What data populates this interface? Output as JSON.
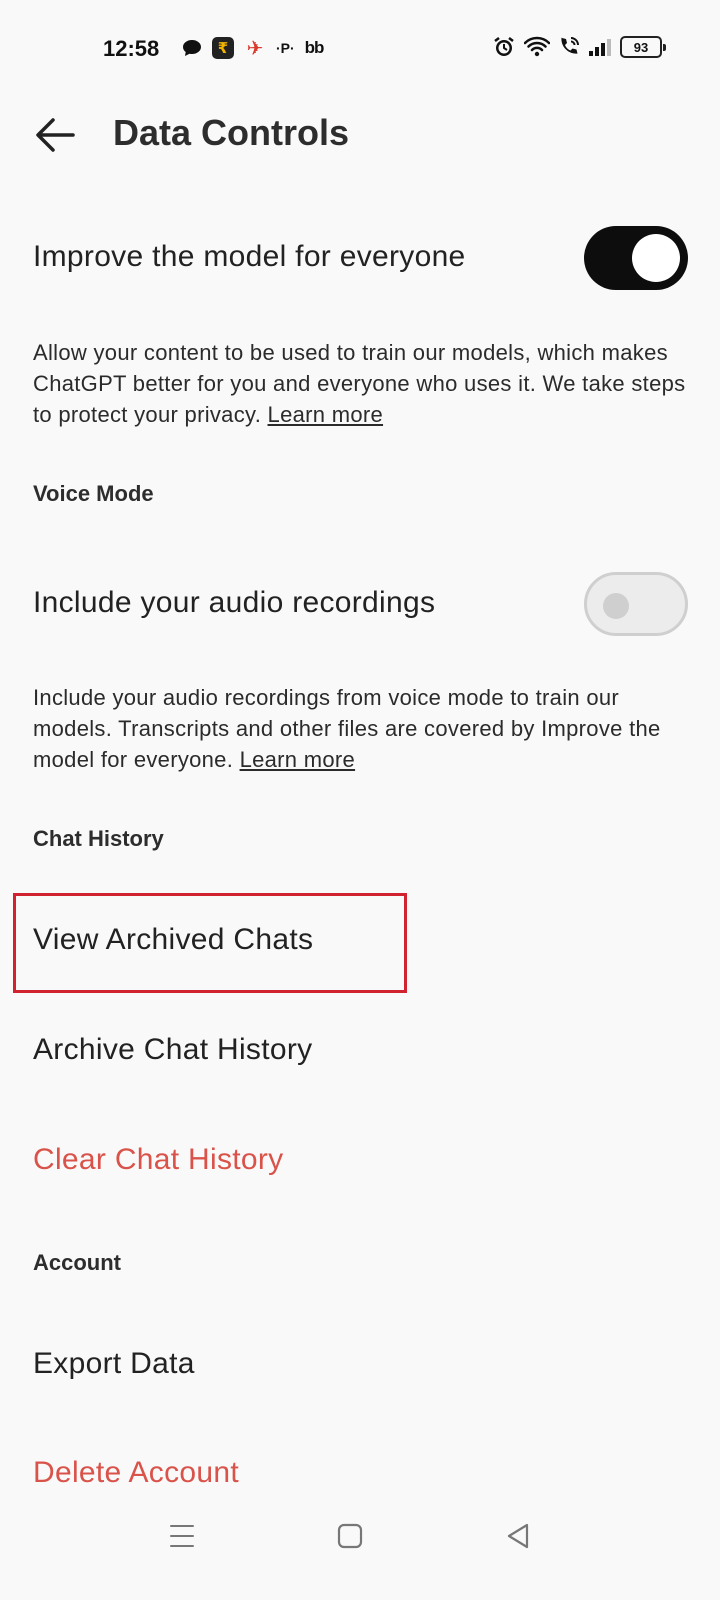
{
  "status_bar": {
    "time": "12:58",
    "left_icons": [
      "chat-bubble-icon",
      "app-icon",
      "app-icon",
      "p-icon",
      "bb-icon"
    ],
    "p_text": "·P·",
    "bb_text": "bb",
    "right_icons": [
      "alarm-icon",
      "wifi-icon",
      "call-icon",
      "signal-icon",
      "battery-icon"
    ],
    "battery_level": "93"
  },
  "header": {
    "back_icon": "arrow-left-icon",
    "title": "Data Controls"
  },
  "improve_model": {
    "label": "Improve the model for everyone",
    "enabled": true,
    "description": "Allow your content to be used to train our models, which makes ChatGPT better for you and everyone who uses it. We take steps to protect your privacy.",
    "link": "Learn more"
  },
  "voice_mode": {
    "section_title": "Voice Mode",
    "label": "Include your audio recordings",
    "enabled": false,
    "description": "Include your audio recordings from voice mode to train our models. Transcripts and other files are covered by Improve the model for everyone.",
    "link": "Learn more"
  },
  "chat_history": {
    "section_title": "Chat History",
    "view_archived": "View Archived Chats",
    "archive_history": "Archive Chat History",
    "clear_history": "Clear Chat History"
  },
  "account": {
    "section_title": "Account",
    "export_data": "Export Data",
    "delete_account": "Delete Account"
  },
  "colors": {
    "danger": "#d9534a",
    "highlight": "#d0232f",
    "toggle_on": "#0d0d0d"
  },
  "nav_bar": {
    "icons": [
      "menu-icon",
      "home-square-icon",
      "back-triangle-icon"
    ]
  }
}
